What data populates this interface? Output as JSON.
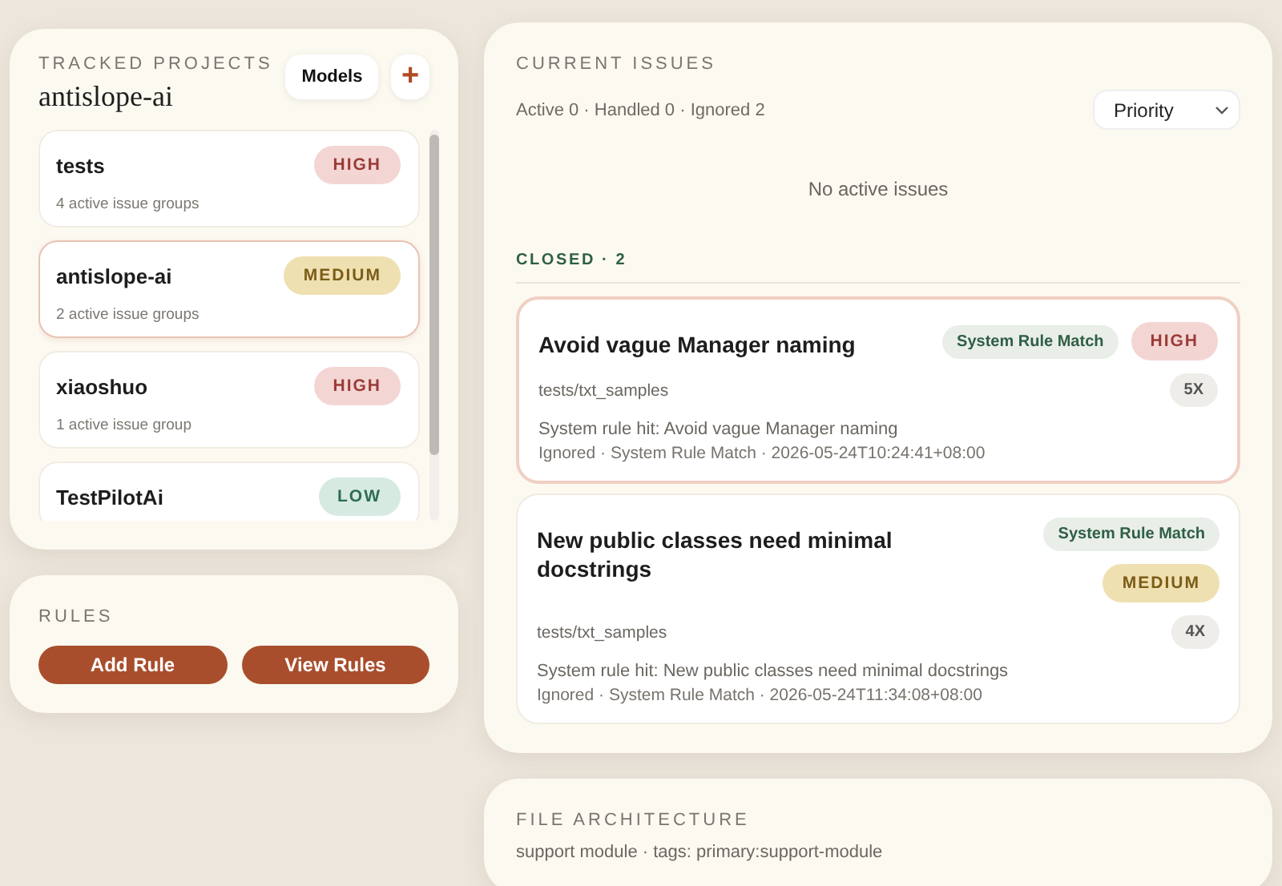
{
  "projects_panel": {
    "heading": "TRACKED PROJECTS",
    "current_project": "antislope-ai",
    "models_button": "Models",
    "add_button": "+",
    "projects": [
      {
        "name": "tests",
        "kind": "high",
        "badge": "HIGH",
        "summary": "4 active issue groups",
        "selected": false
      },
      {
        "name": "antislope-ai",
        "kind": "medium",
        "badge": "MEDIUM",
        "summary": "2 active issue groups",
        "selected": true
      },
      {
        "name": "xiaoshuo",
        "kind": "high",
        "badge": "HIGH",
        "summary": "1 active issue group",
        "selected": false
      },
      {
        "name": "TestPilotAi",
        "kind": "low",
        "badge": "LOW",
        "selected": false
      }
    ]
  },
  "rules_panel": {
    "heading": "RULES",
    "buttons": [
      "Add Rule",
      "View Rules"
    ]
  },
  "issues_panel": {
    "heading": "CURRENT ISSUES",
    "stats": "Active 0 · Handled 0 · Ignored 2",
    "sort_select": "Priority",
    "empty_message": "No active issues",
    "closed_heading": "CLOSED · 2",
    "issues": [
      {
        "title": "Avoid vague Manager naming",
        "source_tag": "System Rule Match",
        "kind": "high",
        "badge": "HIGH",
        "path": "tests/txt_samples",
        "count": "5X",
        "message": "System rule hit: Avoid vague Manager naming",
        "meta": "Ignored · System Rule Match · 2026-05-24T10:24:41+08:00",
        "selected": true
      },
      {
        "title": "New public classes need minimal docstrings",
        "source_tag": "System Rule Match",
        "kind": "medium",
        "badge": "MEDIUM",
        "path": "tests/txt_samples",
        "count": "4X",
        "message": "System rule hit: New public classes need minimal docstrings",
        "meta": "Ignored · System Rule Match · 2026-05-24T11:34:08+08:00",
        "selected": false
      }
    ]
  },
  "architecture_panel": {
    "heading": "FILE ARCHITECTURE",
    "summary": "support module · tags: primary:support-module"
  }
}
